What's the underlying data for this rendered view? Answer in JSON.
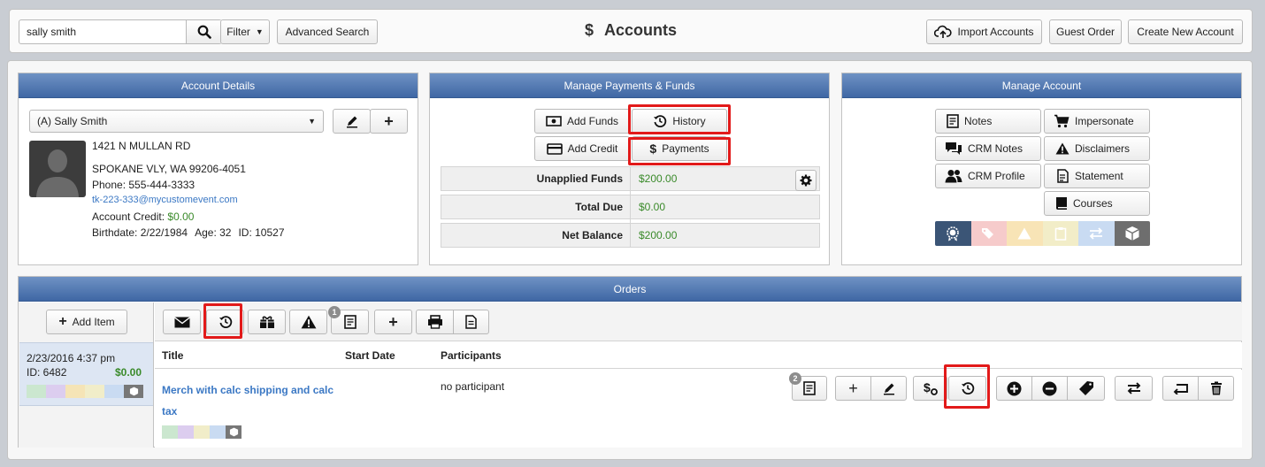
{
  "topbar": {
    "search_value": "sally smith",
    "filter_label": "Filter",
    "advanced_search_label": "Advanced Search",
    "page_title": "Accounts",
    "title_symbol": "$",
    "import_label": "Import Accounts",
    "guest_order_label": "Guest Order",
    "create_label": "Create New Account"
  },
  "account_details": {
    "header": "Account Details",
    "selected_account": "(A) Sally Smith",
    "address1": "1421 N MULLAN RD",
    "address2": "SPOKANE VLY, WA 99206-4051",
    "phone": "Phone: 555-444-3333",
    "email": "tk-223-333@mycustomevent.com",
    "credit_label": "Account Credit:",
    "credit_value": "$0.00",
    "birthdate": "Birthdate: 2/22/1984",
    "age": "Age: 32",
    "id": "ID: 10527"
  },
  "payments": {
    "header": "Manage Payments & Funds",
    "add_funds_label": "Add Funds",
    "history_label": "History",
    "add_credit_label": "Add Credit",
    "payments_label": "Payments",
    "rows": [
      {
        "label": "Unapplied Funds",
        "value": "$200.00"
      },
      {
        "label": "Total Due",
        "value": "$0.00"
      },
      {
        "label": "Net Balance",
        "value": "$200.00"
      }
    ]
  },
  "manage_account": {
    "header": "Manage Account",
    "notes_label": "Notes",
    "impersonate_label": "Impersonate",
    "crm_notes_label": "CRM Notes",
    "disclaimers_label": "Disclaimers",
    "crm_profile_label": "CRM Profile",
    "statement_label": "Statement",
    "courses_label": "Courses",
    "status_colors": [
      "#3b5576",
      "#f6cbcb",
      "#f8e4b6",
      "#f2edc8",
      "#c9dbf2",
      "#6e6e6e"
    ]
  },
  "orders": {
    "header": "Orders",
    "add_item_label": "Add Item",
    "toolbar_notes_badge": "1",
    "order_entry": {
      "datetime": "2/23/2016 4:37 pm",
      "id": "ID: 6482",
      "amount": "$0.00"
    },
    "columns": {
      "title": "Title",
      "start_date": "Start Date",
      "participants": "Participants"
    },
    "item": {
      "title_line1": "Merch with calc shipping and calc",
      "title_line2": "tax",
      "participants": "no participant",
      "notes_badge": "2"
    }
  }
}
